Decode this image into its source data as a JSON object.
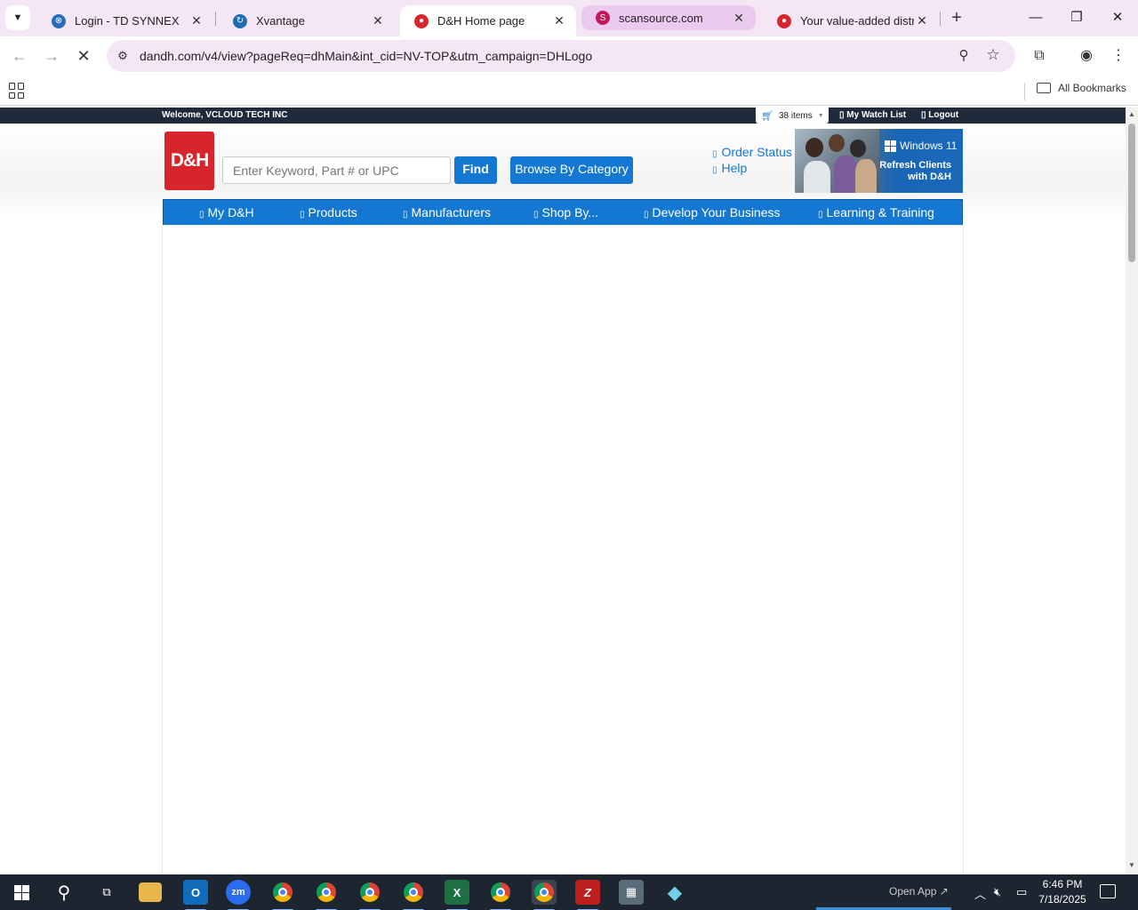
{
  "browser": {
    "tabs": [
      {
        "title": "Login - TD SYNNEX",
        "favicon": "td-synnex-icon",
        "color": "#2a6ebb"
      },
      {
        "title": "Xvantage",
        "favicon": "xvantage-icon",
        "color": "#1f6cb0"
      },
      {
        "title": "D&H Home page",
        "favicon": "dh-icon",
        "color": "#d7262b",
        "active": true
      },
      {
        "title": "scansource.com",
        "favicon": "scansource-icon",
        "color": "#c2185b"
      },
      {
        "title": "Your value-added distrib",
        "favicon": "dh-icon",
        "color": "#d7262b"
      }
    ],
    "url": "dandh.com/v4/view?pageReq=dhMain&int_cid=NV-TOP&utm_campaign=DHLogo",
    "bookmarks_label": "All Bookmarks"
  },
  "site": {
    "welcome": "Welcome, VCLOUD TECH INC",
    "cart_items": "38 items",
    "watch_list": "My Watch List",
    "logout": "Logout",
    "logo_text": "D&H",
    "search_placeholder": "Enter Keyword, Part # or UPC",
    "find_label": "Find",
    "browse_label": "Browse By Category",
    "order_status": "Order Status",
    "help": "Help",
    "banner": {
      "brand": "Windows 11",
      "line1": "Refresh Clients",
      "line2": "with D&H"
    },
    "nav": [
      "My D&H",
      "Products",
      "Manufacturers",
      "Shop By...",
      "Develop Your Business",
      "Learning & Training"
    ],
    "accent_color": "#1478d2",
    "brand_color": "#d7262b"
  },
  "taskbar": {
    "open_app": "Open App",
    "time": "6:46 PM",
    "date": "7/18/2025",
    "apps": [
      "windows-start",
      "search",
      "task-view",
      "file-explorer",
      "outlook",
      "zoom",
      "chrome",
      "chrome",
      "chrome",
      "chrome",
      "excel",
      "chrome",
      "chrome",
      "filezilla",
      "calculator",
      "app"
    ]
  }
}
